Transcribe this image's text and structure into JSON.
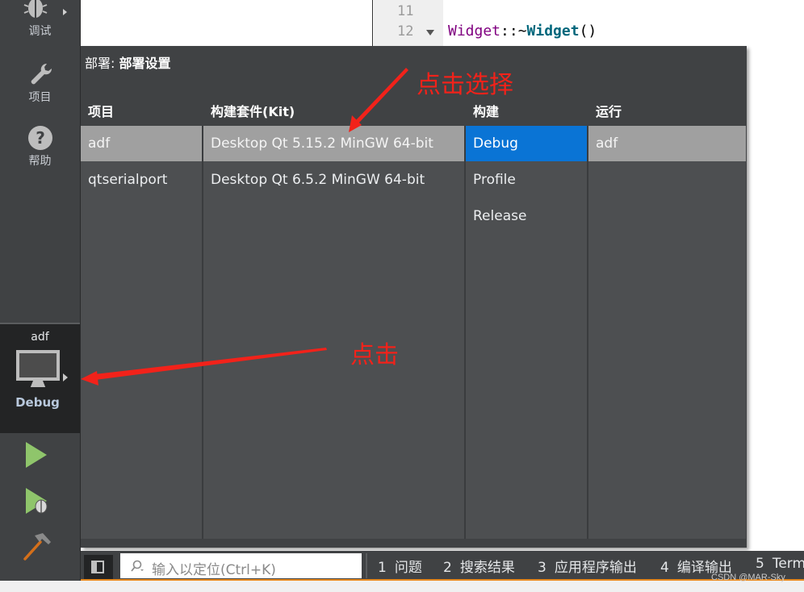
{
  "modebar": {
    "modes": [
      {
        "label": "调试",
        "icon": "bug-icon"
      },
      {
        "label": "项目",
        "icon": "wrench-icon"
      },
      {
        "label": "帮助",
        "icon": "help-icon"
      }
    ],
    "kit_selector": {
      "project": "adf",
      "config": "Debug",
      "icon": "monitor-icon"
    },
    "actions": [
      {
        "name": "run",
        "icon": "run-icon"
      },
      {
        "name": "debug-run",
        "icon": "debug-run-icon"
      },
      {
        "name": "build",
        "icon": "hammer-icon"
      }
    ]
  },
  "editor": {
    "line_numbers": [
      "11",
      "12"
    ],
    "code_line_12": {
      "class": "Widget",
      "sep": "::~",
      "fn": "Widget",
      "parens": "()"
    }
  },
  "popup": {
    "title_prefix": "部署: ",
    "title_value": "部署设置",
    "columns": [
      {
        "header": "项目",
        "items": [
          "adf",
          "qtserialport"
        ],
        "selected": 0,
        "selected_style": "grey"
      },
      {
        "header": "构建套件(Kit)",
        "items": [
          "Desktop Qt 5.15.2 MinGW 64-bit",
          "Desktop Qt 6.5.2 MinGW 64-bit"
        ],
        "selected": 0,
        "selected_style": "grey"
      },
      {
        "header": "构建",
        "items": [
          "Debug",
          "Profile",
          "Release"
        ],
        "selected": 0,
        "selected_style": "blue"
      },
      {
        "header": "运行",
        "items": [
          "adf"
        ],
        "selected": 0,
        "selected_style": "grey"
      }
    ]
  },
  "output_bar": {
    "search_placeholder": "输入以定位(Ctrl+K)",
    "tabs": [
      {
        "num": "1",
        "label": "问题"
      },
      {
        "num": "2",
        "label": "搜索结果"
      },
      {
        "num": "3",
        "label": "应用程序输出"
      },
      {
        "num": "4",
        "label": "编译输出"
      },
      {
        "num": "5",
        "label": "Term"
      }
    ]
  },
  "annotations": {
    "top": "点击选择",
    "middle": "点击"
  },
  "watermark": "CSDN @MAR-Sky",
  "colors": {
    "accent_blue": "#0a74d5",
    "annotation_red": "#f2221a",
    "status_orange": "#e8891e"
  }
}
